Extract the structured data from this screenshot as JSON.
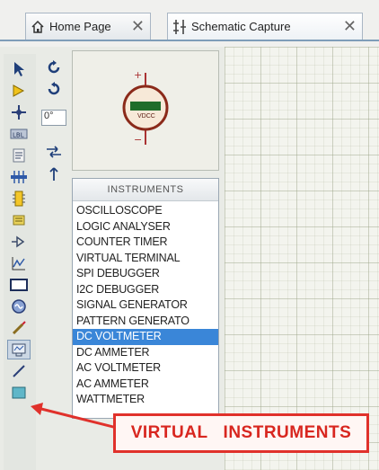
{
  "tabs": [
    {
      "label": "Home Page",
      "icon": "home-icon"
    },
    {
      "label": "Schematic Capture",
      "icon": "schematic-icon",
      "active": true
    }
  ],
  "rotation": {
    "value": "0°"
  },
  "preview": {
    "device_label": "VDCC"
  },
  "device_panel": {
    "header": "INSTRUMENTS",
    "items": [
      "OSCILLOSCOPE",
      "LOGIC ANALYSER",
      "COUNTER TIMER",
      "VIRTUAL TERMINAL",
      "SPI DEBUGGER",
      "I2C DEBUGGER",
      "SIGNAL GENERATOR",
      "PATTERN GENERATO",
      "DC VOLTMETER",
      "DC AMMETER",
      "AC VOLTMETER",
      "AC AMMETER",
      "WATTMETER"
    ],
    "selected_index": 8
  },
  "annotation": {
    "text": "VIRTUAL   INSTRUMENTS"
  },
  "colors": {
    "accent": "#e0312b",
    "selection": "#3a86d8"
  }
}
